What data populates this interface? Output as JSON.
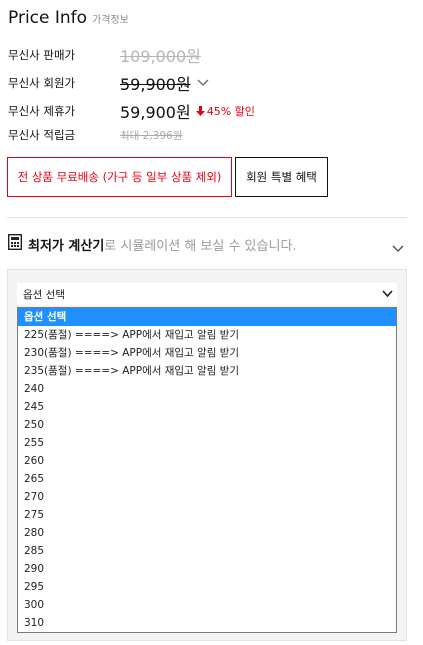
{
  "header": {
    "title": "Price Info",
    "subtitle": "가격정보"
  },
  "prices": {
    "sale": {
      "label": "무신사 판매가",
      "value": "109,000원"
    },
    "member": {
      "label": "무신사 회원가",
      "value": "59,900원"
    },
    "partner": {
      "label": "무신사 제휴가",
      "value": "59,900원",
      "discount": "45% 할인"
    },
    "points": {
      "label": "무신사 적립금",
      "value": "최대 2,396원"
    }
  },
  "buttons": {
    "free_shipping": "전 상품 무료배송 (가구 등 일부 상품 제외)",
    "member_benefit": "회원 특별 혜택"
  },
  "calculator": {
    "title": "최저가 계산기",
    "description": "로 시뮬레이션 해 보실 수 있습니다."
  },
  "select": {
    "value": "옵션 선택",
    "options": [
      "옵션 선택",
      "225(품절) ====> APP에서 재입고 알림 받기",
      "230(품절) ====> APP에서 재입고 알림 받기",
      "235(품절) ====> APP에서 재입고 알림 받기",
      "240",
      "245",
      "250",
      "255",
      "260",
      "265",
      "270",
      "275",
      "280",
      "285",
      "290",
      "295",
      "300",
      "310"
    ]
  },
  "colors": {
    "accent": "#e60012",
    "highlight": "#1e90ff"
  }
}
